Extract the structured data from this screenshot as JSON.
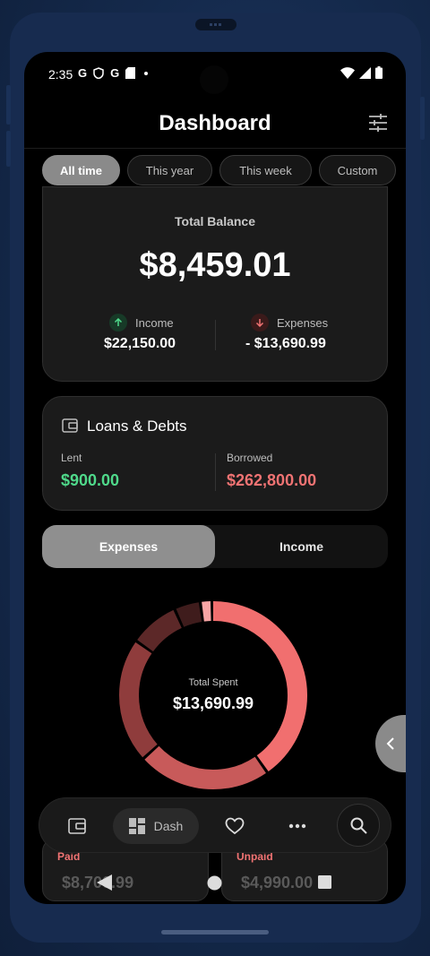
{
  "status": {
    "time": "2:35",
    "icons": [
      "g-icon",
      "shield-icon",
      "g-icon",
      "sd-card-icon",
      "dot-icon"
    ]
  },
  "header": {
    "title": "Dashboard"
  },
  "filters": [
    {
      "label": "All time",
      "active": true
    },
    {
      "label": "This year",
      "active": false
    },
    {
      "label": "This week",
      "active": false
    },
    {
      "label": "Custom",
      "active": false
    }
  ],
  "balance": {
    "label": "Total Balance",
    "amount": "$8,459.01",
    "income_label": "Income",
    "income_value": "$22,150.00",
    "expenses_label": "Expenses",
    "expenses_value": "- $13,690.99"
  },
  "loans": {
    "title": "Loans & Debts",
    "lent_label": "Lent",
    "lent_value": "$900.00",
    "borrowed_label": "Borrowed",
    "borrowed_value": "$262,800.00"
  },
  "toggle": {
    "expenses": "Expenses",
    "income": "Income",
    "active": "expenses"
  },
  "donut": {
    "label": "Total Spent",
    "value": "$13,690.99",
    "segments": [
      {
        "share": 0.405,
        "color": "#f16f6f"
      },
      {
        "share": 0.23,
        "color": "#c85a5a"
      },
      {
        "share": 0.215,
        "color": "#8f3c3c"
      },
      {
        "share": 0.085,
        "color": "#5c2828"
      },
      {
        "share": 0.045,
        "color": "#3f1c1c"
      },
      {
        "share": 0.02,
        "color": "#f7a5a5"
      }
    ]
  },
  "bottom_cards": {
    "paid_label": "Paid",
    "paid_value": "$8,700.99",
    "unpaid_label": "Unpaid",
    "unpaid_value": "$4,990.00"
  },
  "nav": {
    "active_label": "Dash"
  },
  "colors": {
    "accent_green": "#4fd98a",
    "accent_red": "#f07373",
    "chip_active": "#8a8a8a"
  }
}
